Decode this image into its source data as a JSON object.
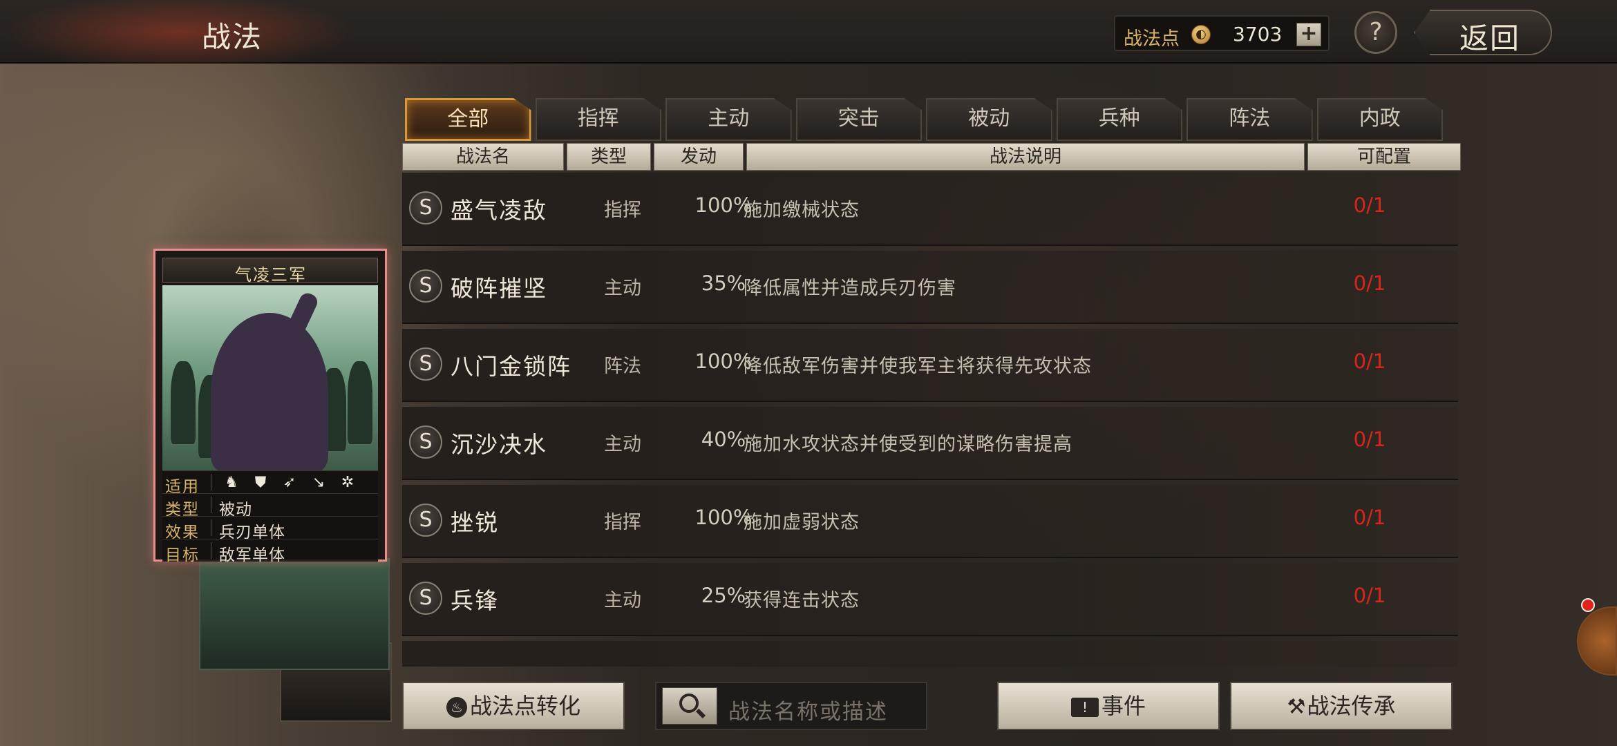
{
  "header": {
    "title": "战法",
    "points_label": "战法点",
    "points_icon": "coin-icon",
    "points_value": "3703",
    "plus_label": "+",
    "help_label": "?",
    "back_label": "返回"
  },
  "tabs": [
    {
      "label": "全部",
      "active": true
    },
    {
      "label": "指挥",
      "active": false
    },
    {
      "label": "主动",
      "active": false
    },
    {
      "label": "突击",
      "active": false
    },
    {
      "label": "被动",
      "active": false
    },
    {
      "label": "兵种",
      "active": false
    },
    {
      "label": "阵法",
      "active": false
    },
    {
      "label": "内政",
      "active": false
    }
  ],
  "columns": {
    "name": "战法名",
    "type": "类型",
    "rate": "发动",
    "desc": "战法说明",
    "conf": "可配置"
  },
  "rows": [
    {
      "grade": "S",
      "name": "盛气凌敌",
      "type": "指挥",
      "rate": "100%",
      "desc": "施加缴械状态",
      "conf": "0/1"
    },
    {
      "grade": "S",
      "name": "破阵摧坚",
      "type": "主动",
      "rate": "35%",
      "desc": "降低属性并造成兵刃伤害",
      "conf": "0/1"
    },
    {
      "grade": "S",
      "name": "八门金锁阵",
      "type": "阵法",
      "rate": "100%",
      "desc": "降低敌军伤害并使我军主将获得先攻状态",
      "conf": "0/1"
    },
    {
      "grade": "S",
      "name": "沉沙决水",
      "type": "主动",
      "rate": "40%",
      "desc": "施加水攻状态并使受到的谋略伤害提高",
      "conf": "0/1"
    },
    {
      "grade": "S",
      "name": "挫锐",
      "type": "指挥",
      "rate": "100%",
      "desc": "施加虚弱状态",
      "conf": "0/1"
    },
    {
      "grade": "S",
      "name": "兵锋",
      "type": "主动",
      "rate": "25%",
      "desc": "获得连击状态",
      "conf": "0/1"
    }
  ],
  "card": {
    "title": "气凌三军",
    "applies_label": "适用",
    "applies_icons": [
      "cavalry-icon",
      "shield-icon",
      "archer-icon",
      "spear-icon",
      "wheel-icon"
    ],
    "type_label": "类型",
    "type_value": "被动",
    "effect_label": "效果",
    "effect_value": "兵刃单体",
    "target_label": "目标",
    "target_value": "敌军单体"
  },
  "footer": {
    "convert_label": "战法点转化",
    "search_placeholder": "战法名称或描述",
    "event_label": "事件",
    "inherit_label": "战法传承"
  },
  "colors": {
    "accent": "#d89a3c",
    "conf_red": "#d8261c",
    "card_border": "#e88d8a"
  }
}
